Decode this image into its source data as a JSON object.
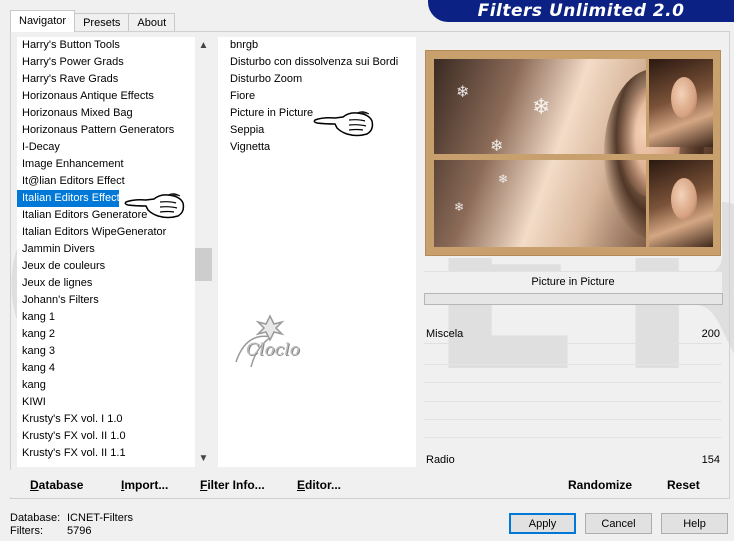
{
  "tabs": [
    "Navigator",
    "Presets",
    "About"
  ],
  "app_title": "Filters Unlimited 2.0",
  "categories": [
    "Harry's Button Tools",
    "Harry's Power Grads",
    "Harry's Rave Grads",
    "Horizonaus Antique Effects",
    "Horizonaus Mixed Bag",
    "Horizonaus Pattern Generators",
    "I-Decay",
    "Image Enhancement",
    "It@lian Editors Effect",
    "Italian Editors Effect",
    "Italian Editors Generatore",
    "Italian Editors WipeGenerator",
    "Jammin Divers",
    "Jeux de couleurs",
    "Jeux de lignes",
    "Johann's Filters",
    "kang 1",
    "kang 2",
    "kang 3",
    "kang 4",
    "kang",
    "KIWI",
    "Krusty's FX vol. I 1.0",
    "Krusty's FX vol. II 1.0",
    "Krusty's FX vol. II 1.1"
  ],
  "selected_category": "Italian Editors Effect",
  "filters": [
    "bnrgb",
    "Disturbo con dissolvenza sui Bordi",
    "Disturbo Zoom",
    "Fiore",
    "Picture in Picture",
    "Seppia",
    "Vignetta"
  ],
  "selected_filter": "Picture in Picture",
  "logo_text": "Cloclo",
  "filter_name": "Picture in Picture",
  "params": [
    {
      "label": "Miscela",
      "value": "200"
    },
    {
      "label": "Radio",
      "value": "154"
    }
  ],
  "left_buttons": {
    "database": {
      "ul": "D",
      "rest": "atabase"
    },
    "import": {
      "ul": "I",
      "rest": "mport..."
    },
    "filter_info": {
      "ul": "F",
      "rest": "ilter Info..."
    },
    "editor": {
      "ul": "E",
      "rest": "ditor..."
    }
  },
  "right_buttons": {
    "randomize": "Randomize",
    "reset": "Reset"
  },
  "status": {
    "database_label": "Database:",
    "database_value": "ICNET-Filters",
    "filters_label": "Filters:",
    "filters_value": "5796"
  },
  "dialog": {
    "apply": "Apply",
    "cancel": "Cancel",
    "help": "Help"
  },
  "colors": {
    "selection": "#0078d7",
    "banner": "#0b2183",
    "frame": "#c8a06e"
  }
}
